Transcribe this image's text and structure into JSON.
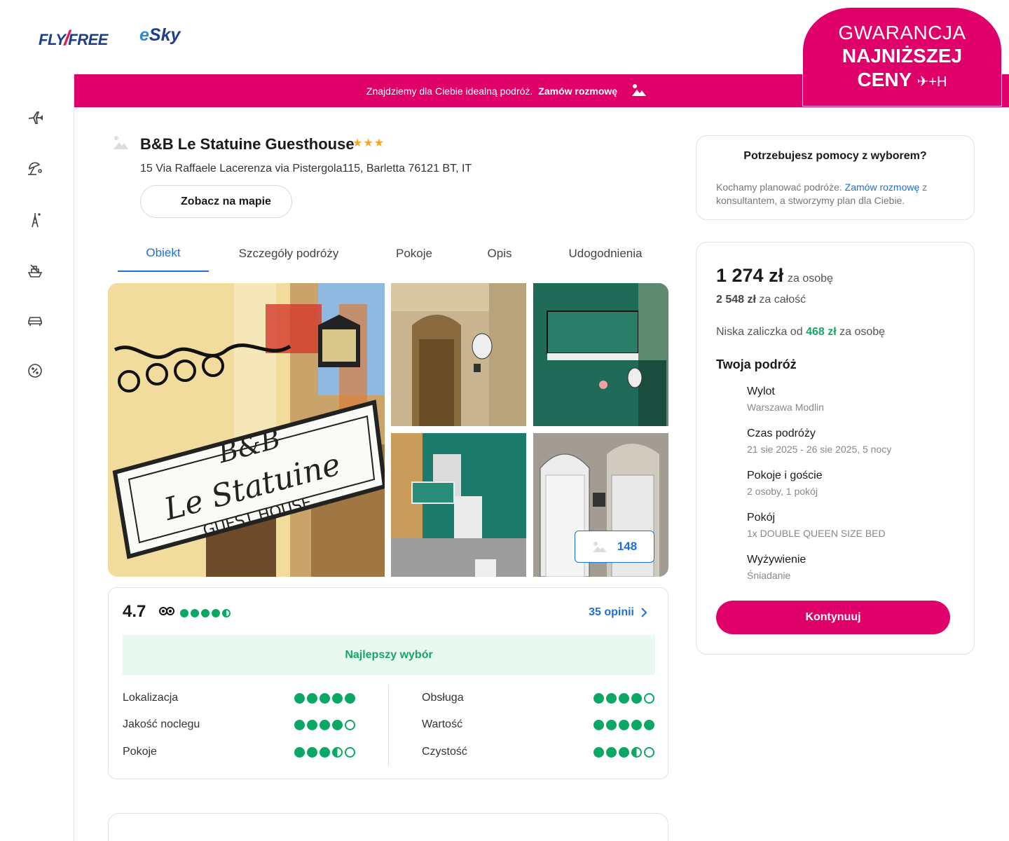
{
  "brand": {
    "logo1": "FLY FREE",
    "logo2": "eSky"
  },
  "guarantee": {
    "line1": "GWARANCJA",
    "line2": "NAJNIŻSZEJ",
    "line3": "CENY",
    "icon_text": "✈+H"
  },
  "promo": {
    "text": "Znajdziemy dla Ciebie idealną podróż.",
    "link": "Zamów rozmowę"
  },
  "sidebar": {
    "items": [
      {
        "icon": "plane-icon"
      },
      {
        "icon": "beach-icon"
      },
      {
        "icon": "city-break-icon"
      },
      {
        "icon": "cruise-icon"
      },
      {
        "icon": "car-icon"
      },
      {
        "icon": "discount-icon"
      }
    ]
  },
  "hotel": {
    "name": "B&B Le Statuine Guesthouse",
    "stars": "★★★",
    "address": "15 Via Raffaele Lacerenza via Pistergola115, Barletta 76121 BT, IT",
    "map_button": "Zobacz na mapie"
  },
  "tabs": [
    {
      "label": "Obiekt",
      "active": true
    },
    {
      "label": "Szczegóły podróży",
      "active": false
    },
    {
      "label": "Pokoje",
      "active": false
    },
    {
      "label": "Opis",
      "active": false
    },
    {
      "label": "Udogodnienia",
      "active": false
    }
  ],
  "gallery": {
    "sign_line1": "B&B",
    "sign_line2": "Le Statuine",
    "sign_line3": "GUEST HOUSE",
    "photo_count": "148"
  },
  "rating": {
    "score": "4.7",
    "reviews": "35 opinii",
    "best": "Najlepszy wybór",
    "categories": [
      {
        "label": "Lokalizacja",
        "value": 5
      },
      {
        "label": "Jakość noclegu",
        "value": 4
      },
      {
        "label": "Pokoje",
        "value": 3.5
      },
      {
        "label": "Obsługa",
        "value": 4
      },
      {
        "label": "Wartość",
        "value": 5
      },
      {
        "label": "Czystość",
        "value": 3.5
      }
    ],
    "overall_value": 4.5
  },
  "help": {
    "title": "Potrzebujesz pomocy z wyborem?",
    "text_before": "Kochamy planować podróże.",
    "link": "Zamów rozmowę",
    "text_after": "z konsultantem, a stworzymy plan dla Ciebie."
  },
  "price": {
    "per_person": "1 274 zł",
    "per_person_unit": "za osobę",
    "total": "2 548 zł",
    "total_unit": "za całość",
    "deposit_before": "Niska zaliczka od",
    "deposit_value": "468 zł",
    "deposit_after": "za osobę",
    "trip_title": "Twoja podróż",
    "trip": [
      {
        "title": "Wylot",
        "value": "Warszawa Modlin"
      },
      {
        "title": "Czas podróży",
        "value": "21 sie 2025 - 26 sie 2025, 5 nocy"
      },
      {
        "title": "Pokoje i goście",
        "value": "2 osoby, 1 pokój"
      },
      {
        "title": "Pokój",
        "value": "1x DOUBLE QUEEN SIZE BED"
      },
      {
        "title": "Wyżywienie",
        "value": "Śniadanie"
      }
    ],
    "continue": "Kontynuuj"
  },
  "colors": {
    "brand_pink": "#e0006a",
    "link_blue": "#1e6fd9",
    "rating_green": "#0aa864"
  }
}
